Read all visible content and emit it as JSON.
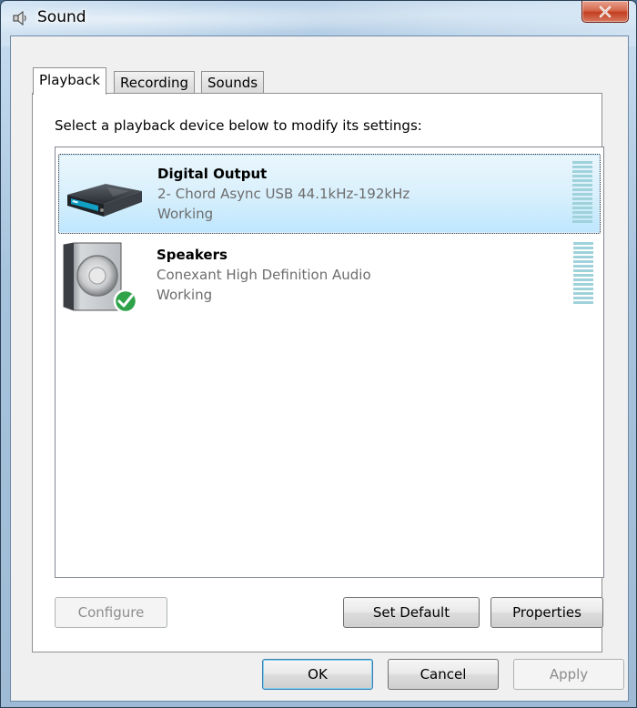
{
  "window": {
    "title": "Sound"
  },
  "tabs": [
    {
      "label": "Playback",
      "active": true
    },
    {
      "label": "Recording",
      "active": false
    },
    {
      "label": "Sounds",
      "active": false
    }
  ],
  "playback": {
    "instruction": "Select a playback device below to modify its settings:",
    "devices": [
      {
        "name": "Digital Output",
        "description": "2- Chord Async USB 44.1kHz-192kHz",
        "status": "Working",
        "icon": "digital-output-icon",
        "selected": true
      },
      {
        "name": "Speakers",
        "description": "Conexant High Definition Audio",
        "status": "Working",
        "icon": "speaker-icon",
        "default_device": true
      }
    ]
  },
  "panel_buttons": {
    "configure": "Configure",
    "set_default": "Set Default",
    "properties": "Properties"
  },
  "dialog_buttons": {
    "ok": "OK",
    "cancel": "Cancel",
    "apply": "Apply"
  },
  "colors": {
    "close_button": "#c94a2f",
    "selection": "#d9f0fc",
    "default_check": "#2fa34a"
  }
}
